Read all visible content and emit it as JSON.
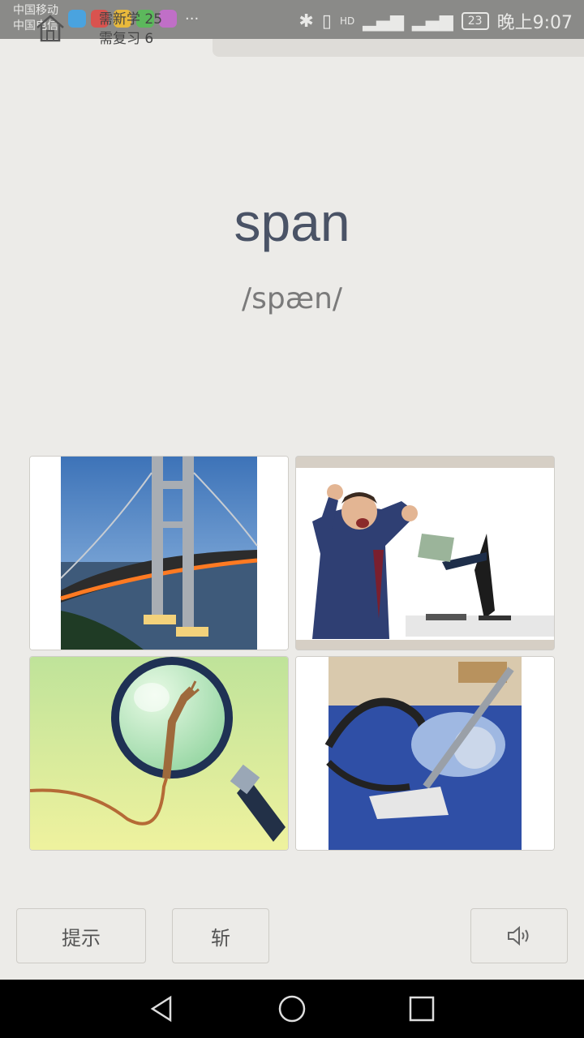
{
  "status_bar": {
    "carrier_1": "中国移动",
    "carrier_2": "中国电信",
    "battery": "23",
    "time": "晚上9:07",
    "dots": "···"
  },
  "header": {
    "new_learn": "需新学 25",
    "review": "需复习 6"
  },
  "word": {
    "text": "span",
    "phonetic": "/spæn/"
  },
  "choices": [
    {
      "icon": "bridge-image"
    },
    {
      "icon": "money-from-computer-image"
    },
    {
      "icon": "magnifying-glass-rope-image"
    },
    {
      "icon": "vacuum-cleaner-image"
    }
  ],
  "buttons": {
    "hint": "提示",
    "kill": "斩"
  },
  "colors": {
    "background": "#ECEBE8",
    "word": "#4a5366",
    "phonetic": "#7a7a7a",
    "status_bar": "#8a8a88",
    "nav_bar": "#000000"
  }
}
